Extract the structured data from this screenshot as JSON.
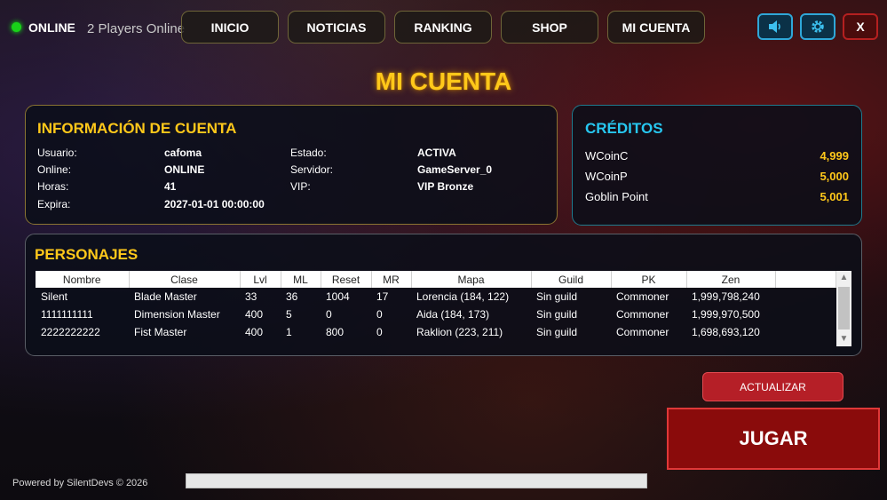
{
  "status": {
    "label": "ONLINE",
    "players": "2 Players Online"
  },
  "nav": {
    "items": [
      "INICIO",
      "NOTICIAS",
      "RANKING",
      "SHOP",
      "MI CUENTA"
    ]
  },
  "window_buttons": {
    "close": "X",
    "sound_icon": "speaker-icon",
    "settings_icon": "gear-icon"
  },
  "page_title": "MI CUENTA",
  "account": {
    "title": "INFORMACIÓN DE CUENTA",
    "left": [
      {
        "label": "Usuario:",
        "value": "cafoma"
      },
      {
        "label": "Online:",
        "value": "ONLINE"
      },
      {
        "label": "Horas:",
        "value": "41"
      },
      {
        "label": "Expira:",
        "value": "2027-01-01 00:00:00"
      }
    ],
    "right": [
      {
        "label": "Estado:",
        "value": "ACTIVA"
      },
      {
        "label": "Servidor:",
        "value": "GameServer_0"
      },
      {
        "label": "VIP:",
        "value": "VIP Bronze"
      }
    ]
  },
  "credits": {
    "title": "CRÉDITOS",
    "items": [
      {
        "label": "WCoinC",
        "value": "4,999"
      },
      {
        "label": "WCoinP",
        "value": "5,000"
      },
      {
        "label": "Goblin Point",
        "value": "5,001"
      }
    ]
  },
  "characters": {
    "title": "PERSONAJES",
    "columns": [
      "Nombre",
      "Clase",
      "Lvl",
      "ML",
      "Reset",
      "MR",
      "Mapa",
      "Guild",
      "PK",
      "Zen",
      ""
    ],
    "rows": [
      [
        "Silent",
        "Blade Master",
        "33",
        "36",
        "1004",
        "17",
        "Lorencia (184, 122)",
        "Sin guild",
        "Commoner",
        "1,999,798,240",
        ""
      ],
      [
        "1111111111",
        "Dimension Master",
        "400",
        "5",
        "0",
        "0",
        "Aida (184, 173)",
        "Sin guild",
        "Commoner",
        "1,999,970,500",
        ""
      ],
      [
        "2222222222",
        "Fist Master",
        "400",
        "1",
        "800",
        "0",
        "Raklion (223, 211)",
        "Sin guild",
        "Commoner",
        "1,698,693,120",
        ""
      ]
    ]
  },
  "actions": {
    "update": "ACTUALIZAR",
    "play": "JUGAR"
  },
  "footer": "Powered by SilentDevs © 2026",
  "progress": {
    "fraction": 0
  },
  "colors": {
    "gold": "#ffc81a",
    "cyan": "#27c7f0",
    "red": "#b51f27",
    "online": "#19d219"
  }
}
